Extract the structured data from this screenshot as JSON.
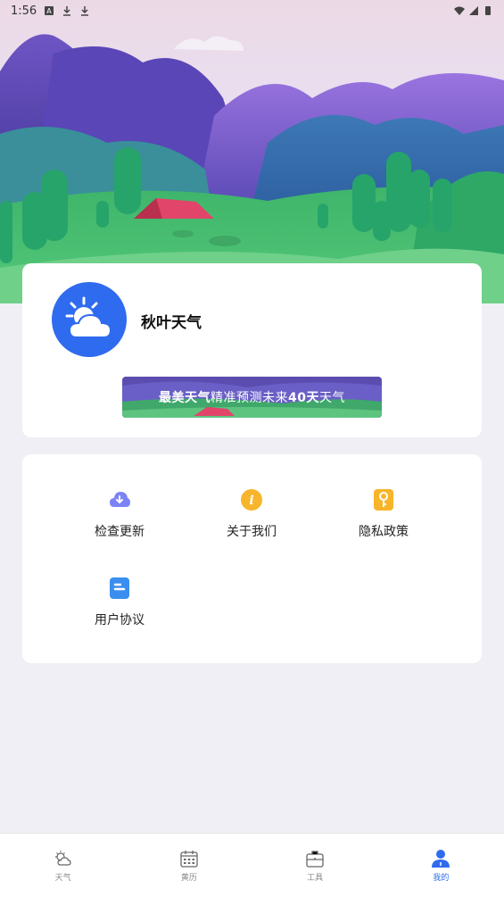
{
  "status": {
    "time": "1:56"
  },
  "profile": {
    "app_name": "秋叶天气",
    "banner": {
      "part1": "最美天气",
      "part2": "精准预测未来",
      "part3": "40天",
      "part4": "天气"
    }
  },
  "menu": [
    {
      "label": "检查更新",
      "icon": "cloud-download-icon",
      "color": "#7b83f5"
    },
    {
      "label": "关于我们",
      "icon": "info-icon",
      "color": "#f7b52b"
    },
    {
      "label": "隐私政策",
      "icon": "key-icon",
      "color": "#f7b52b"
    },
    {
      "label": "用户协议",
      "icon": "document-icon",
      "color": "#3a8ef0"
    }
  ],
  "tabs": [
    {
      "label": "天气",
      "icon": "weather-icon",
      "active": false
    },
    {
      "label": "黄历",
      "icon": "calendar-icon",
      "active": false
    },
    {
      "label": "工具",
      "icon": "toolbox-icon",
      "active": false
    },
    {
      "label": "我的",
      "icon": "user-icon",
      "active": true
    }
  ],
  "colors": {
    "accent": "#2f6bef",
    "background": "#f0eff5"
  }
}
